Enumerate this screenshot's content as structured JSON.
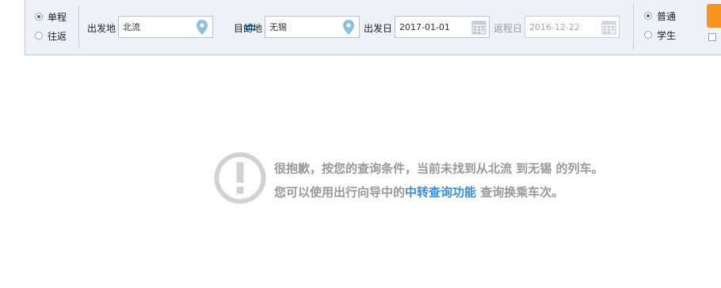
{
  "trip_type": {
    "options": [
      {
        "label": "单程",
        "checked": true
      },
      {
        "label": "往返",
        "checked": false
      }
    ]
  },
  "from": {
    "label": "出发地",
    "value": "北流",
    "icon": "location-pin-icon"
  },
  "swap": {
    "icon": "swap-arrows-icon"
  },
  "to": {
    "label": "目的地",
    "value": "无锡",
    "icon": "location-pin-icon"
  },
  "depart_date": {
    "label": "出发日",
    "value": "2017-01-01",
    "icon": "calendar-icon"
  },
  "return_date": {
    "label": "返程日",
    "value": "2016-12-22",
    "icon": "calendar-icon"
  },
  "passenger_type": {
    "options": [
      {
        "label": "普通",
        "checked": true
      },
      {
        "label": "学生",
        "checked": false
      }
    ]
  },
  "message": {
    "part1": "很抱歉，按您的查询条件，当前未找到从北流 到无锡 的列车。您可以使用出行向导中的",
    "link": "中转查询功能",
    "part2": " 查询换乘车次。"
  },
  "colors": {
    "bar_bg": "#eef1f8",
    "bar_border": "#bfcde6",
    "accent_orange": "#f8941d",
    "link_blue": "#3a8fd6",
    "icon_blue": "#8dbfe3",
    "message_gray": "#999999"
  }
}
